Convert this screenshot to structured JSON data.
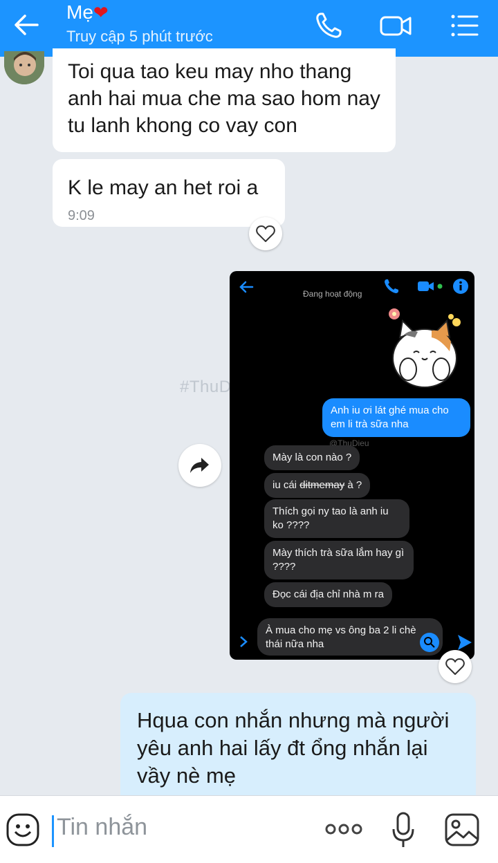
{
  "header": {
    "title": "Mẹ",
    "title_emoji": "❤",
    "subtitle": "Truy cập 5 phút trước",
    "icons": [
      "back-arrow-icon",
      "phone-icon",
      "video-call-icon",
      "menu-list-icon"
    ]
  },
  "messages": {
    "incoming_1": "Toi qua tao keu may nho thang anh hai mua che ma sao hom nay tu lanh khong co vay con",
    "incoming_2": "K le may an het roi a",
    "incoming_2_time": "9:09",
    "outgoing_1": "Hqua con nhắn nhưng mà người yêu anh hai lấy đt ổng nhắn lại vầy nè mẹ"
  },
  "watermark": "#ThuDieu",
  "screenshot": {
    "status": "Đang hoạt động",
    "watermark": "@ThuDieu",
    "messages": [
      {
        "from": "me",
        "text": "Anh iu ơi lát ghé mua cho em li trà sữa nha"
      },
      {
        "from": "them",
        "text": "Mày là con nào ?"
      },
      {
        "from": "them",
        "text_before": "iu cái ",
        "text_struck": "ditmemay",
        "text_after": " à ?"
      },
      {
        "from": "them",
        "text": "Thích gọi ny tao là anh iu ko ????"
      },
      {
        "from": "them",
        "text": "Mày thích trà sữa lắm hay gì ????"
      },
      {
        "from": "them",
        "text": "Đọc cái địa chỉ nhà m ra"
      }
    ],
    "input_text": "À mua cho mẹ vs ông ba 2 li chè thái nữa nha"
  },
  "composer": {
    "placeholder": "Tin nhắn",
    "more_label": "ooo",
    "icons": [
      "emoji-icon",
      "more-icon",
      "microphone-icon",
      "image-icon"
    ]
  },
  "colors": {
    "header_bg": "#1c94ff",
    "chat_bg": "#e6eaef",
    "outgoing_bubble": "#d7eefd",
    "incoming_bubble": "#ffffff"
  }
}
